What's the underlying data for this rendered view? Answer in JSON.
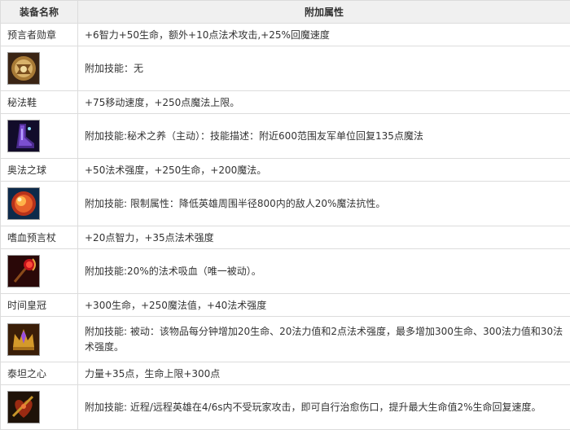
{
  "header": {
    "col_name": "装备名称",
    "col_attr": "附加属性"
  },
  "items": [
    {
      "name": "预言者勋章",
      "stats": "+6智力+50生命，额外+10点法术攻击,+25%回魔速度",
      "skill": "附加技能：无",
      "icon": "medallion-icon"
    },
    {
      "name": "秘法鞋",
      "stats": "+75移动速度，+250点魔法上限。",
      "skill": "附加技能:秘术之养（主动）：技能描述：附近600范围友军单位回复135点魔法",
      "icon": "arcane-boots-icon"
    },
    {
      "name": "奥法之球",
      "stats": "+50法术强度，+250生命，+200魔法。",
      "skill": "附加技能: 限制属性：降低英雄周围半径800内的敌人20%魔法抗性。",
      "icon": "arcane-orb-icon"
    },
    {
      "name": "嗜血预言杖",
      "stats": "+20点智力，+35点法术强度",
      "skill": "附加技能:20%的法术吸血（唯一被动）。",
      "icon": "bloodthirst-staff-icon"
    },
    {
      "name": "时间皇冠",
      "stats": "+300生命，+250魔法值，+40法术强度",
      "skill": "附加技能: 被动：该物品每分钟增加20生命、20法力值和2点法术强度，最多增加300生命、300法力值和30法术强度。",
      "icon": "time-crown-icon"
    },
    {
      "name": "泰坦之心",
      "stats": "力量+35点，生命上限+300点",
      "skill": "附加技能: 近程/远程英雄在4/6s内不受玩家攻击，即可自行治愈伤口，提升最大生命值2%生命回复速度。",
      "icon": "titan-heart-icon"
    }
  ]
}
